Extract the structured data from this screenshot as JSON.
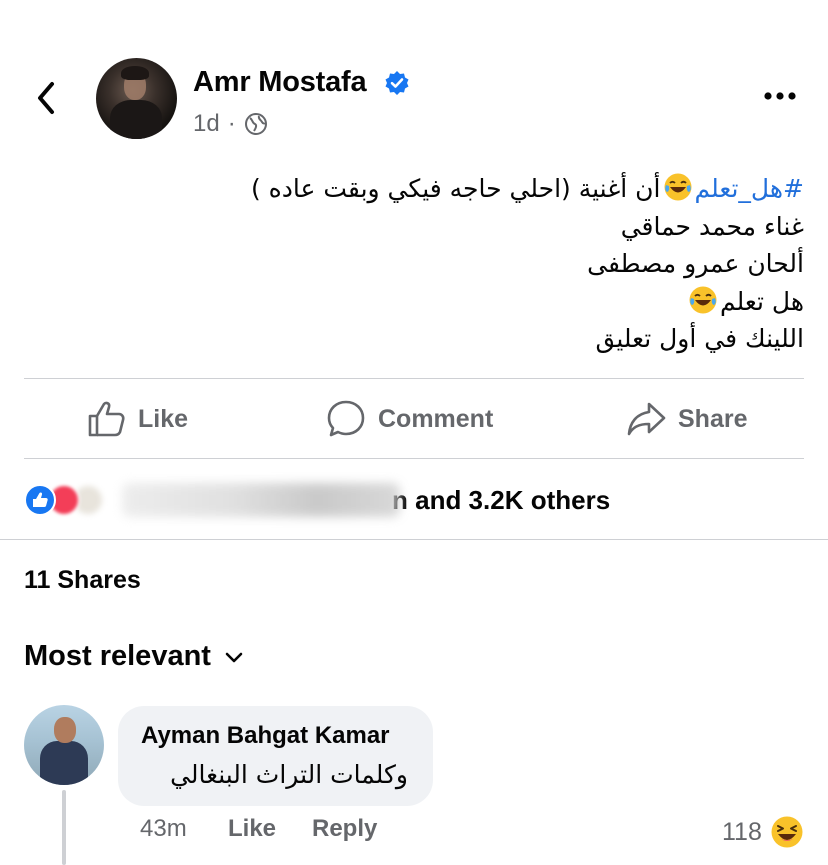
{
  "post": {
    "author": "Amr Mostafa",
    "time": "1d",
    "separator": "·",
    "lines": {
      "line1_hashtag": "#هل_تعلم",
      "line1_rest": "أن أغنية (احلي حاجه فيكي وبقت عاده )",
      "line2": "غناء  محمد حماقي",
      "line3": "ألحان عمرو مصطفى",
      "line4": "هل تعلم",
      "line5": "اللينك في أول تعليق"
    },
    "icons": {
      "back": "chevron-left-icon",
      "verified": "verified-badge-icon",
      "audience": "globe-icon",
      "more": "more-horizontal-icon",
      "emoji": "laughing-tears-emoji"
    }
  },
  "actions": {
    "like": "Like",
    "comment": "Comment",
    "share": "Share"
  },
  "reactions": {
    "summary": "n and 3.2K others",
    "types": [
      "like",
      "love",
      "haha"
    ]
  },
  "shares": "11 Shares",
  "sort": {
    "label": "Most relevant"
  },
  "comment": {
    "author": "Ayman Bahgat Kamar",
    "text": "وكلمات التراث البنغالي",
    "time": "43m",
    "like": "Like",
    "reply": "Reply",
    "reaction_count": "118",
    "reaction_type": "haha"
  },
  "colors": {
    "accent": "#1877f2",
    "hashtag": "#216fdb",
    "secondary_text": "#65676b",
    "divider": "#ced0d4",
    "bubble": "#f0f2f5"
  }
}
